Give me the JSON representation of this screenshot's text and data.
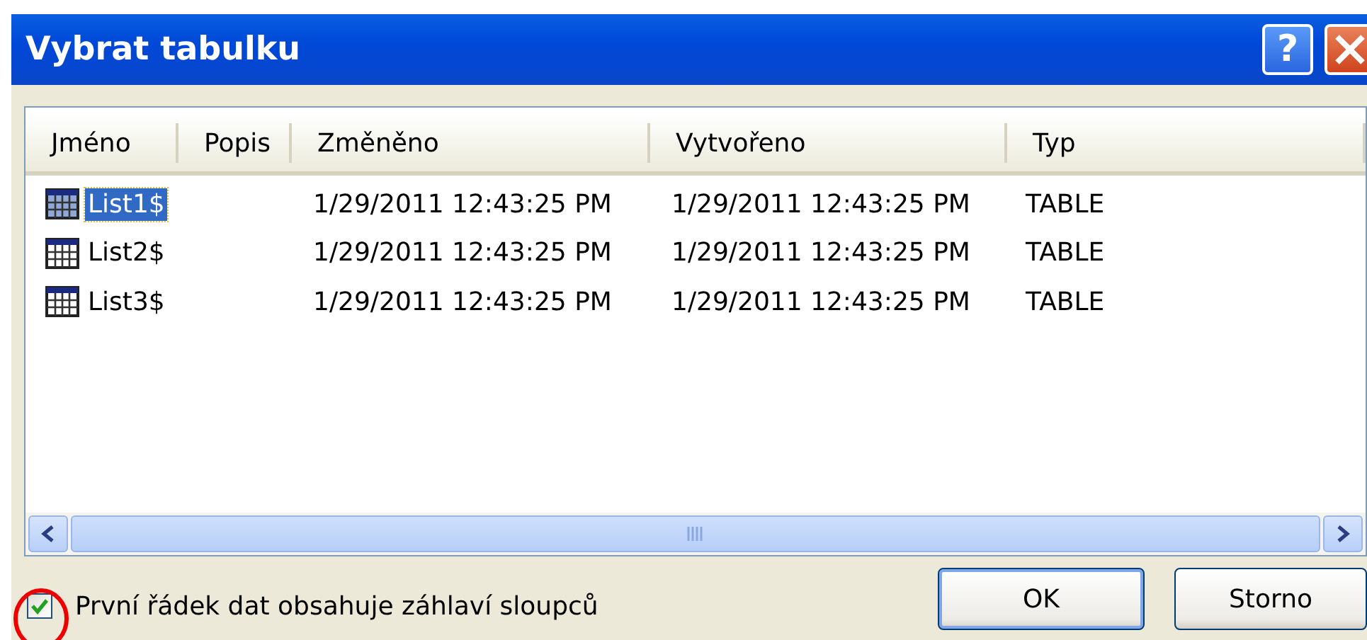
{
  "window": {
    "title": "Vybrat tabulku",
    "help_button": "?"
  },
  "list": {
    "columns": [
      "Jméno",
      "Popis",
      "Změněno",
      "Vytvořeno",
      "Typ"
    ],
    "rows": [
      {
        "name": "List1$",
        "modified": "1/29/2011 12:43:25 PM",
        "created": "1/29/2011 12:43:25 PM",
        "type": "TABLE",
        "selected": true
      },
      {
        "name": "List2$",
        "modified": "1/29/2011 12:43:25 PM",
        "created": "1/29/2011 12:43:25 PM",
        "type": "TABLE",
        "selected": false
      },
      {
        "name": "List3$",
        "modified": "1/29/2011 12:43:25 PM",
        "created": "1/29/2011 12:43:25 PM",
        "type": "TABLE",
        "selected": false
      }
    ]
  },
  "checkbox": {
    "label": "První řádek dat obsahuje záhlaví sloupců",
    "checked": true
  },
  "buttons": [
    {
      "label": "OK",
      "default": true
    },
    {
      "label": "Storno",
      "default": false
    }
  ]
}
